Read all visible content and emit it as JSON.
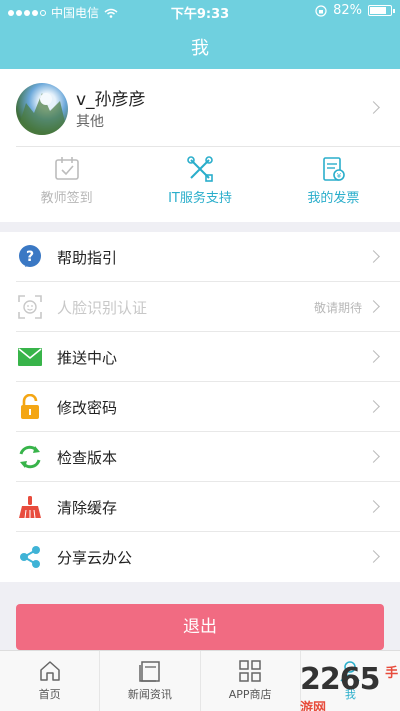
{
  "status_bar": {
    "carrier": "中国电信",
    "time": "下午9:33",
    "battery": "82%"
  },
  "header": {
    "title": "我"
  },
  "profile": {
    "name": "v_孙彦彦",
    "role": "其他"
  },
  "quick_actions": [
    {
      "label": "教师签到",
      "icon": "calendar-check-icon",
      "state": "disabled"
    },
    {
      "label": "IT服务支持",
      "icon": "tools-icon",
      "state": "active"
    },
    {
      "label": "我的发票",
      "icon": "invoice-icon",
      "state": "active"
    }
  ],
  "menu": [
    {
      "label": "帮助指引",
      "icon": "help-icon",
      "hint": ""
    },
    {
      "label": "人脸识别认证",
      "icon": "face-recognition-icon",
      "hint": "敬请期待",
      "disabled": true
    },
    {
      "label": "推送中心",
      "icon": "mail-icon",
      "hint": ""
    },
    {
      "label": "修改密码",
      "icon": "lock-icon",
      "hint": ""
    },
    {
      "label": "检查版本",
      "icon": "refresh-icon",
      "hint": ""
    },
    {
      "label": "清除缓存",
      "icon": "broom-icon",
      "hint": ""
    },
    {
      "label": "分享云办公",
      "icon": "share-icon",
      "hint": ""
    }
  ],
  "logout": {
    "label": "退出"
  },
  "tabs": [
    {
      "label": "首页",
      "icon": "home-icon"
    },
    {
      "label": "新闻资讯",
      "icon": "news-icon"
    },
    {
      "label": "APP商店",
      "icon": "app-store-icon"
    },
    {
      "label": "我",
      "icon": "user-icon",
      "active": true
    }
  ],
  "watermark": {
    "number": "2265",
    "suffix": "手游网"
  },
  "colors": {
    "header": "#6fd0df",
    "accent": "#2aaecb",
    "logout": "#f16b82"
  }
}
